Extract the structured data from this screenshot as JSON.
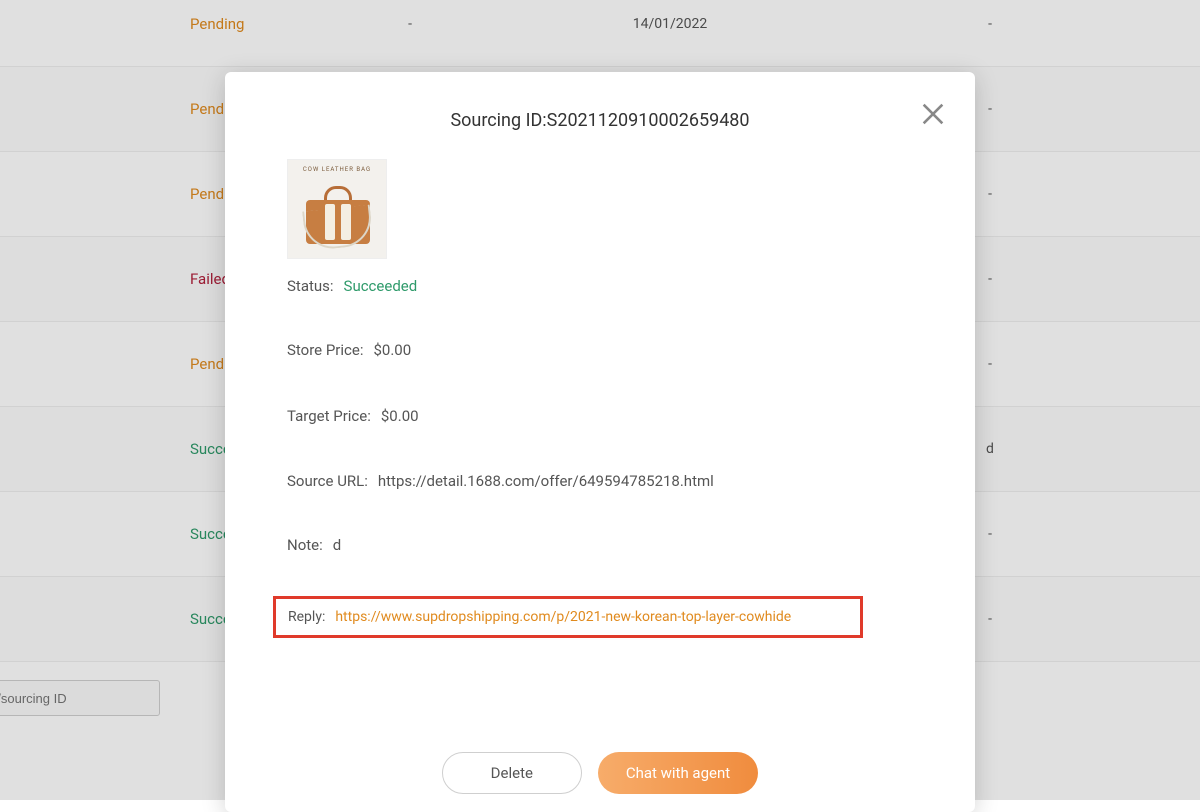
{
  "table": {
    "rows": [
      {
        "status": "Pending",
        "statusClass": "status-pending",
        "col2": "-",
        "date": "14/01/2022",
        "col4": "-"
      },
      {
        "status": "Pending",
        "statusClass": "status-pending",
        "col2": "",
        "date": "",
        "col4": "-"
      },
      {
        "status": "Pending",
        "statusClass": "status-pending",
        "col2": "",
        "date": "",
        "col4": "-"
      },
      {
        "status": "Failed",
        "statusClass": "status-failed",
        "col2": "",
        "date": "",
        "col4": "-"
      },
      {
        "status": "Pending",
        "statusClass": "status-pending",
        "col2": "",
        "date": "",
        "col4": "-"
      },
      {
        "status": "Succeeded",
        "statusClass": "status-succeeded",
        "col2": "",
        "date": "",
        "col4": "d"
      },
      {
        "status": "Succeeded",
        "statusClass": "status-succeeded",
        "col2": "",
        "date": "",
        "col4": "-"
      },
      {
        "status": "Succeeded",
        "statusClass": "status-succeeded",
        "col2": "",
        "date": "",
        "col4": "-"
      }
    ]
  },
  "search": {
    "placeholder": "ct name/sourcing ID"
  },
  "modal": {
    "title": "Sourcing ID:S2021120910002659480",
    "productImageCaption": "COW LEATHER BAG",
    "statusLabel": "Status:",
    "statusValue": "Succeeded",
    "storePriceLabel": "Store Price:",
    "storePriceValue": "$0.00",
    "targetPriceLabel": "Target Price:",
    "targetPriceValue": "$0.00",
    "sourceUrlLabel": "Source URL:",
    "sourceUrlValue": "https://detail.1688.com/offer/649594785218.html",
    "noteLabel": "Note:",
    "noteValue": "d",
    "replyLabel": "Reply:",
    "replyValue": "https://www.supdropshipping.com/p/2021-new-korean-top-layer-cowhide",
    "deleteLabel": "Delete",
    "chatLabel": "Chat with agent"
  }
}
